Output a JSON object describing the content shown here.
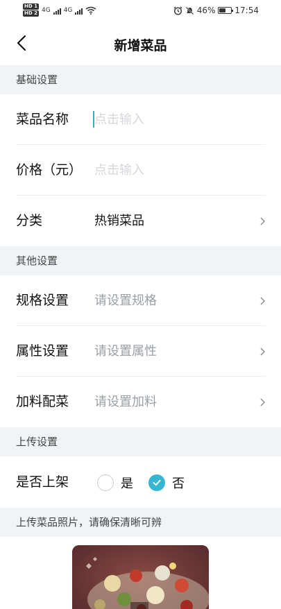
{
  "status_bar": {
    "sim1": "HD 1",
    "sim2": "HD 2",
    "net1": "4G",
    "net2": "4G",
    "battery_percent": "46%",
    "battery_level": 0.46,
    "time": "17:54",
    "icons": [
      "signal-icon",
      "wifi-icon",
      "alarm-icon",
      "mute-icon",
      "battery-icon"
    ]
  },
  "nav": {
    "title": "新增菜品",
    "back_icon": "chevron-left-icon"
  },
  "sections": {
    "basic": "基础设置",
    "other": "其他设置",
    "shelf": "上传设置",
    "photo": "上传菜品照片，请确保清晰可辨"
  },
  "fields": {
    "name": {
      "label": "菜品名称",
      "placeholder": "点击输入"
    },
    "price": {
      "label": "价格（元）",
      "placeholder": "点击输入"
    },
    "category": {
      "label": "分类",
      "value": "热销菜品"
    },
    "spec": {
      "label": "规格设置",
      "value": "请设置规格"
    },
    "attr": {
      "label": "属性设置",
      "value": "请设置属性"
    },
    "extra": {
      "label": "加料配菜",
      "value": "请设置加料"
    },
    "onshelf": {
      "label": "是否上架",
      "options": [
        {
          "label": "是",
          "selected": false
        },
        {
          "label": "否",
          "selected": true
        }
      ]
    }
  },
  "colors": {
    "accent": "#35b6d2",
    "section_bg": "#f1f4f6",
    "placeholder": "#d5d7db",
    "hint": "#9aa0a6"
  }
}
